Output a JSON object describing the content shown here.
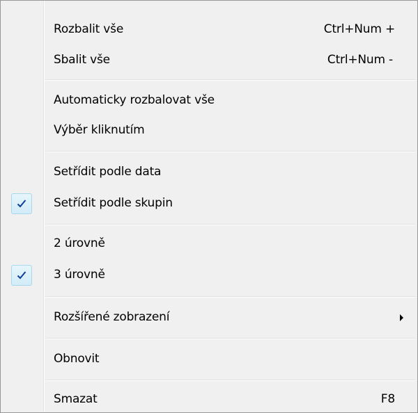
{
  "menu": {
    "items": [
      {
        "label": "Rozbalit vše",
        "shortcut": "Ctrl+Num +",
        "checked": false
      },
      {
        "label": "Sbalit vše",
        "shortcut": "Ctrl+Num -",
        "checked": false
      },
      {
        "label": "Automaticky rozbalovat vše",
        "checked": false
      },
      {
        "label": "Výběr kliknutím",
        "checked": false
      },
      {
        "label": "Setřídit podle data",
        "checked": false
      },
      {
        "label": "Setřídit podle skupin",
        "checked": true
      },
      {
        "label": "2 úrovně",
        "checked": false
      },
      {
        "label": "3 úrovně",
        "checked": true
      },
      {
        "label": "Rozšířené zobrazení",
        "has_submenu": true
      },
      {
        "label": "Obnovit"
      },
      {
        "label": "Smazat",
        "shortcut": "F8"
      }
    ]
  },
  "icons": {
    "check": "checkmark-icon",
    "submenu": "submenu-arrow-icon"
  },
  "colors": {
    "background": "#f0f0f0",
    "check_highlight": "#d2ecf7",
    "check_mark": "#0c3e9e"
  }
}
